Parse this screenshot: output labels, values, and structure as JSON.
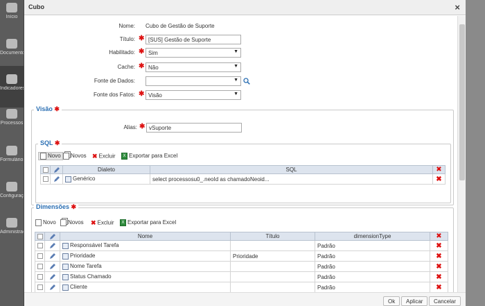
{
  "app": {
    "sidebar": [
      {
        "label": "Início",
        "icon": "home-icon"
      },
      {
        "label": "Documentos",
        "icon": "document-icon"
      },
      {
        "label": "Indicadores",
        "icon": "pie-chart-icon",
        "active": true
      },
      {
        "label": "Processos",
        "icon": "process-icon"
      },
      {
        "label": "Formulários",
        "icon": "form-icon"
      },
      {
        "label": "Configurações",
        "icon": "gears-icon"
      },
      {
        "label": "Administração",
        "icon": "admin-icon"
      }
    ]
  },
  "dialog": {
    "title": "Cubo",
    "close_symbol": "×",
    "fields": {
      "nome_label": "Nome:",
      "nome_value": "Cubo de Gestão de Suporte",
      "titulo_label": "Título:",
      "titulo_value": "[SUS] Gestão de Suporte",
      "habilitado_label": "Habilitado:",
      "habilitado_value": "Sim",
      "cache_label": "Cache:",
      "cache_value": "Não",
      "fonte_dados_label": "Fonte de Dados:",
      "fonte_dados_value": "",
      "fonte_fatos_label": "Fonte dos Fatos:",
      "fonte_fatos_value": "Visão"
    },
    "visao": {
      "legend": "Visão",
      "alias_label": "Alias:",
      "alias_value": "vSuporte",
      "sql": {
        "legend": "SQL",
        "toolbar": {
          "novo": "Novo",
          "novos": "Novos",
          "excluir": "Excluir",
          "exportar": "Exportar para Excel"
        },
        "columns": [
          "Dialeto",
          "SQL"
        ],
        "rows": [
          {
            "dialeto": "Genérico",
            "sql": "select processosu0_.neoId as chamadoNeoid..."
          }
        ]
      }
    },
    "dimensoes": {
      "legend": "Dimensões",
      "toolbar": {
        "novo": "Novo",
        "novos": "Novos",
        "excluir": "Excluir",
        "exportar": "Exportar para Excel"
      },
      "columns": [
        "Nome",
        "Título",
        "dimensionType"
      ],
      "rows": [
        {
          "nome": "Responsável Tarefa",
          "titulo": "",
          "type": "Padrão"
        },
        {
          "nome": "Prioridade",
          "titulo": "Prioridade",
          "type": "Padrão"
        },
        {
          "nome": "Nome Tarefa",
          "titulo": "",
          "type": "Padrão"
        },
        {
          "nome": "Status Chamado",
          "titulo": "",
          "type": "Padrão"
        },
        {
          "nome": "Cliente",
          "titulo": "",
          "type": "Padrão"
        }
      ]
    },
    "footer": {
      "ok": "Ok",
      "aplicar": "Aplicar",
      "cancelar": "Cancelar"
    },
    "required_mark": "✱",
    "dropdown_arrow": "▼",
    "delete_symbol": "✖"
  }
}
